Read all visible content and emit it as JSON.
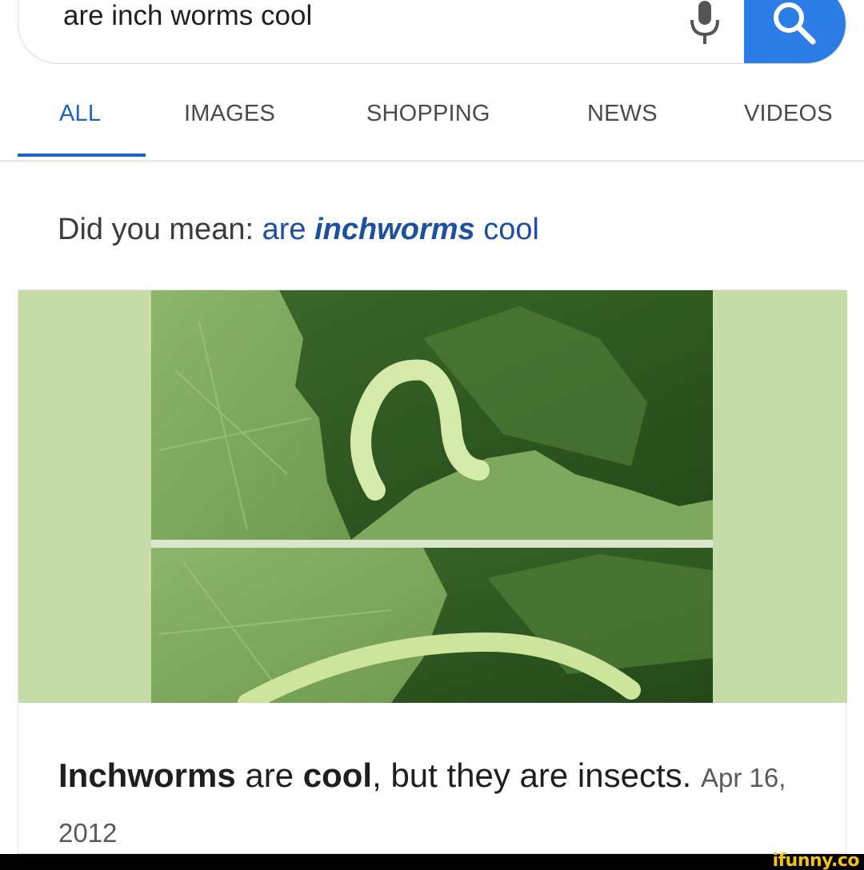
{
  "search": {
    "query": "are inch worms cool",
    "icons": [
      "mic-icon",
      "search-icon"
    ],
    "accent_color": "#2c7ee6"
  },
  "tabs": [
    {
      "label": "ALL",
      "active": true
    },
    {
      "label": "IMAGES",
      "active": false
    },
    {
      "label": "SHOPPING",
      "active": false
    },
    {
      "label": "NEWS",
      "active": false
    },
    {
      "label": "VIDEOS",
      "active": false
    }
  ],
  "suggestion": {
    "prefix": "Did you mean:",
    "pre": "are",
    "bold": "inchworms",
    "post": "cool"
  },
  "result": {
    "bold1": "Inchworms",
    "text1": "are",
    "bold2": "cool",
    "text2": ", but they are insects.",
    "date": "Apr 16, 2012"
  },
  "watermark": "ifunny.co"
}
